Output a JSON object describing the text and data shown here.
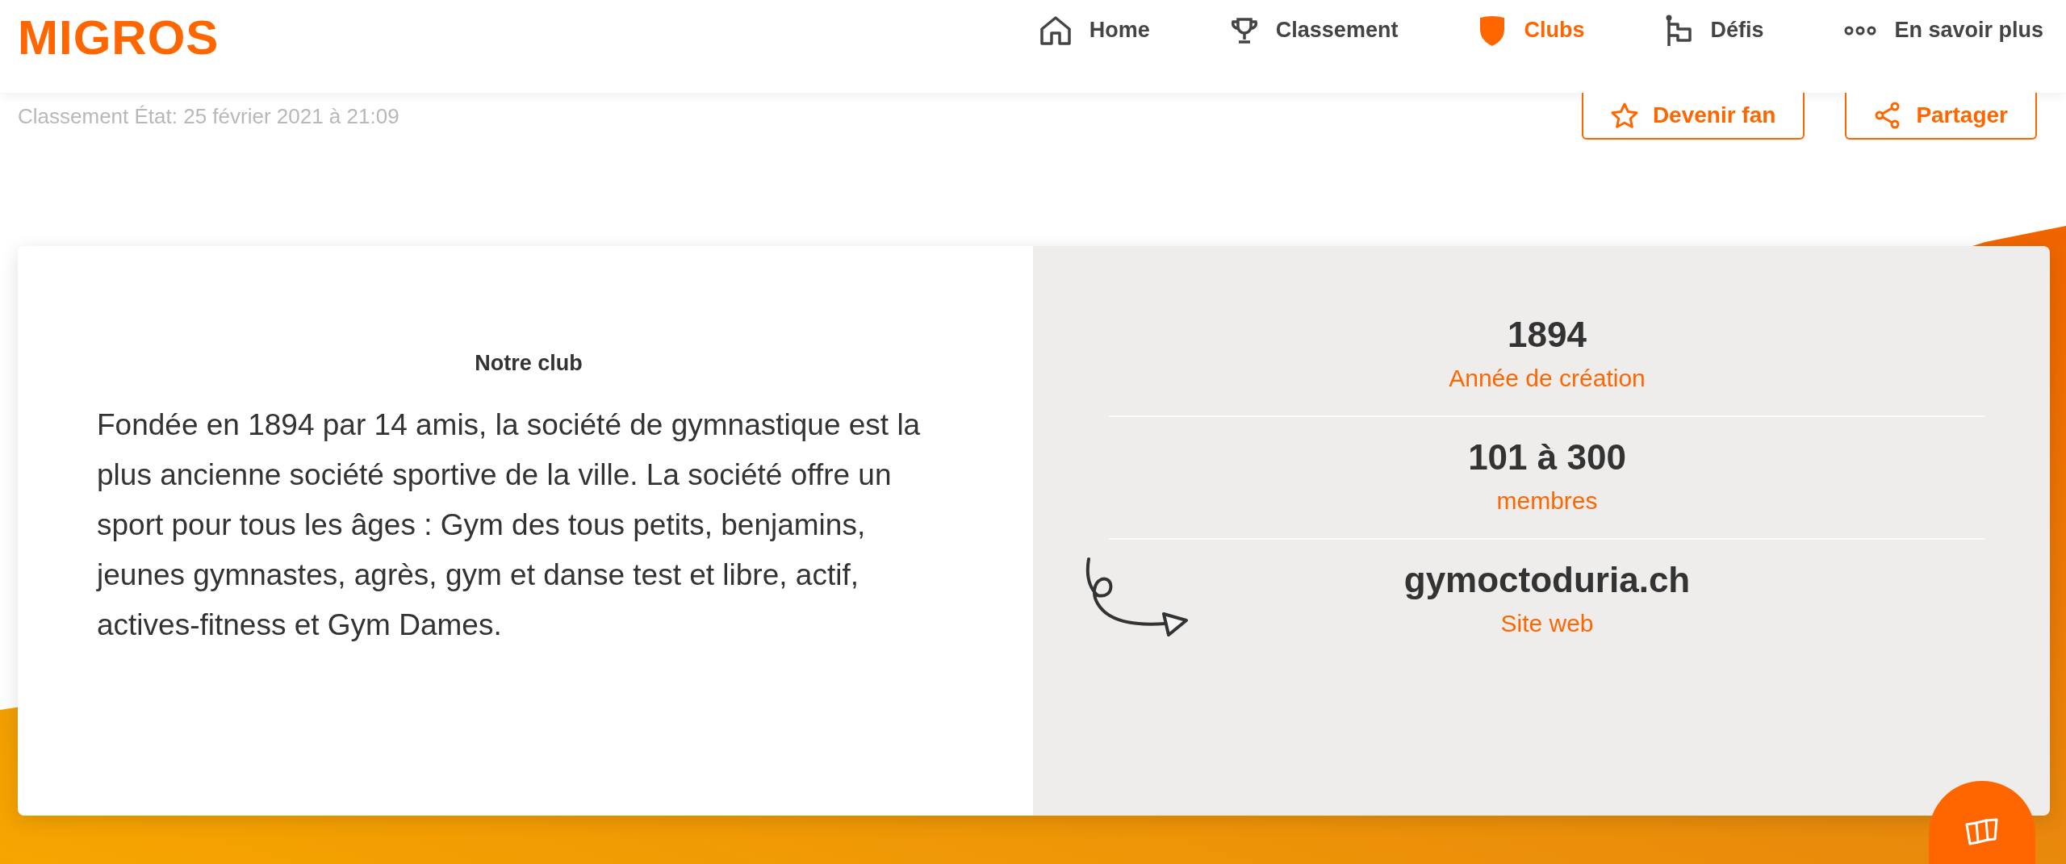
{
  "header": {
    "logo": "MIGROS",
    "nav": [
      {
        "label": "Home",
        "selected": false
      },
      {
        "label": "Classement",
        "selected": false
      },
      {
        "label": "Clubs",
        "selected": true
      },
      {
        "label": "Défis",
        "selected": false
      },
      {
        "label": "En savoir plus",
        "selected": false
      }
    ]
  },
  "status_text": "Classement État: 25 février 2021 à 21:09",
  "actions": [
    {
      "label": "Devenir fan"
    },
    {
      "label": "Partager"
    }
  ],
  "club": {
    "heading": "Notre club",
    "description": "Fondée en 1894 par 14 amis, la société de gymnastique est la plus ancienne société sportive de la ville. La société offre un sport pour tous les âges : Gym des tous petits, benjamins, jeunes gymnastes, agrès, gym et danse test et libre, actif, actives-fitness et Gym Dames."
  },
  "stats": [
    {
      "value": "1894",
      "label": "Année de création"
    },
    {
      "value": "101 à 300",
      "label": "membres"
    },
    {
      "value": "gymoctoduria.ch",
      "label": "Site web"
    }
  ]
}
